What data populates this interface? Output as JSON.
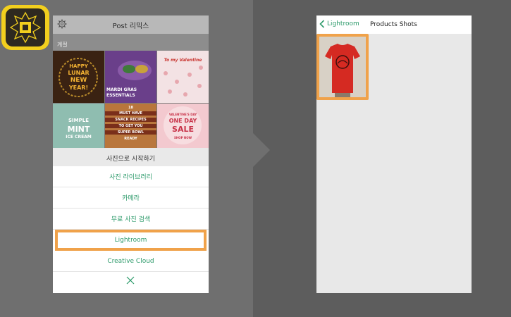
{
  "app_icon": {
    "icon": "spark-post-logo-icon"
  },
  "left_phone": {
    "header": {
      "title": "Post 리믹스",
      "settings_icon": "gear-icon"
    },
    "section_label": "계절",
    "tiles": [
      {
        "name": "lunar-new-year",
        "lines": [
          "HAPPY",
          "LUNAR",
          "NEW",
          "YEAR!"
        ],
        "colors": {
          "bg": "#3a1a12",
          "fg": "#f2b233"
        }
      },
      {
        "name": "mardi-gras",
        "lines": [
          "MARDI GRAS",
          "ESSENTIALS"
        ],
        "colors": {
          "bg": "#6a3f8a",
          "fg": "#ffffff"
        }
      },
      {
        "name": "valentine",
        "lines": [
          "To my Valentine"
        ],
        "colors": {
          "bg": "#f3e2e4",
          "fg": "#c8342f"
        }
      },
      {
        "name": "mint-ice-cream",
        "lines": [
          "SIMPLE",
          "MINT",
          "ICE CREAM"
        ],
        "colors": {
          "bg": "#8fbdb0",
          "fg": "#ffffff"
        }
      },
      {
        "name": "snack-recipes",
        "lines": [
          "18",
          "MUST HAVE",
          "SNACK RECIPES",
          "TO GET YOU",
          "SUPER BOWL",
          "READY"
        ],
        "colors": {
          "bg": "#c7864a",
          "fg": "#ffffff"
        }
      },
      {
        "name": "valentines-sale",
        "lines": [
          "VALENTINE'S DAY",
          "ONE DAY",
          "SALE",
          "SHOP NOW"
        ],
        "colors": {
          "bg": "#f0c0c6",
          "fg": "#c8344a"
        }
      }
    ],
    "sheet": {
      "title": "사진으로 시작하기",
      "options": [
        "사진 라이브러리",
        "카메라",
        "무료 사진 검색",
        "Lightroom",
        "Creative Cloud"
      ],
      "close_icon": "close-icon"
    }
  },
  "right_phone": {
    "header": {
      "back_label": "Lightroom",
      "back_icon": "chevron-left-icon",
      "title": "Products Shots"
    }
  },
  "colors": {
    "accent": "#2c9a6a",
    "highlight": "#f0a24a",
    "app_yellow": "#f2cf1e"
  }
}
